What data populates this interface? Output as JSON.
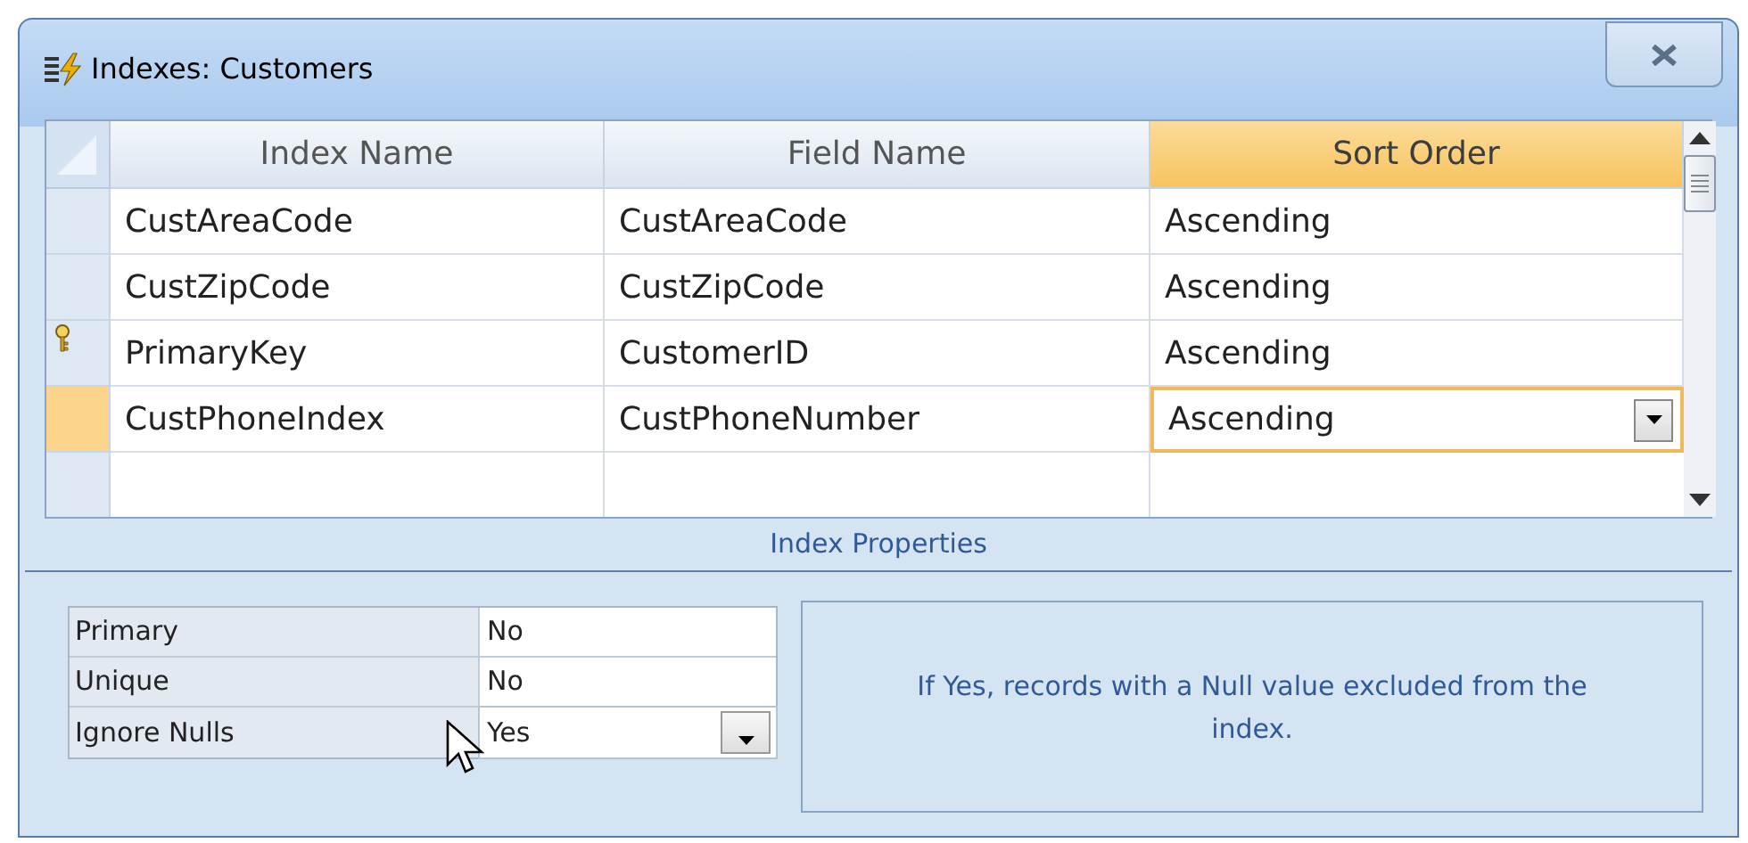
{
  "window": {
    "title": "Indexes: Customers"
  },
  "table": {
    "columns": [
      {
        "label": "Index Name",
        "selected": false
      },
      {
        "label": "Field Name",
        "selected": false
      },
      {
        "label": "Sort Order",
        "selected": true
      }
    ],
    "rows": [
      {
        "cells": [
          "CustAreaCode",
          "CustAreaCode",
          "Ascending"
        ],
        "primary_key": false,
        "selected": false
      },
      {
        "cells": [
          "CustZipCode",
          "CustZipCode",
          "Ascending"
        ],
        "primary_key": false,
        "selected": false
      },
      {
        "cells": [
          "PrimaryKey",
          "CustomerID",
          "Ascending"
        ],
        "primary_key": true,
        "selected": false
      },
      {
        "cells": [
          "CustPhoneIndex",
          "CustPhoneNumber",
          "Ascending"
        ],
        "primary_key": false,
        "selected": true
      }
    ]
  },
  "index_properties": {
    "title": "Index Properties",
    "properties": [
      {
        "label": "Primary",
        "value": "No",
        "selected": false
      },
      {
        "label": "Unique",
        "value": "No",
        "selected": false
      },
      {
        "label": "Ignore Nulls",
        "value": "Yes",
        "selected": true
      }
    ],
    "description": "If Yes, records with a Null value excluded from the index."
  }
}
